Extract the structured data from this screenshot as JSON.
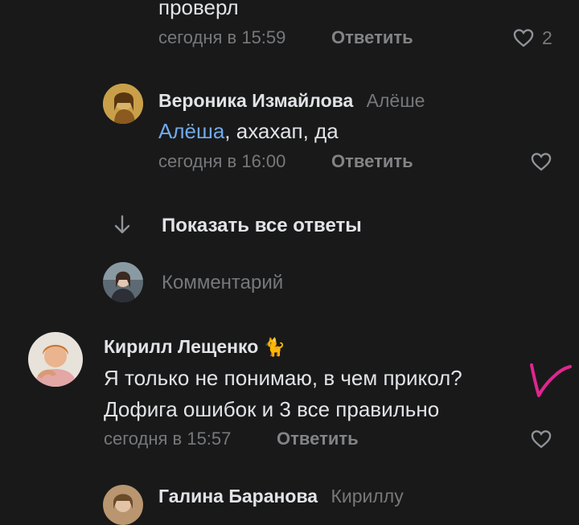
{
  "comment_top": {
    "text_tail": "проверл",
    "time": "сегодня в 15:59",
    "reply_label": "Ответить",
    "likes": "2"
  },
  "reply_veronika": {
    "author": "Вероника Измайлова",
    "reply_to": "Алёше",
    "mention": "Алёша",
    "text": ", ахахап, да",
    "time": "сегодня в 16:00",
    "reply_label": "Ответить"
  },
  "show_replies": {
    "label": "Показать все ответы"
  },
  "reply_input": {
    "placeholder": "Комментарий"
  },
  "comment_kirill": {
    "author": "Кирилл Лещенко",
    "emoji": "🐈",
    "line1": "Я только не понимаю, в чем прикол?",
    "line2": "Дофига ошибок и 3 все правильно",
    "time": "сегодня в 15:57",
    "reply_label": "Ответить",
    "annotation": "V"
  },
  "comment_galina": {
    "author": "Галина Баранова",
    "reply_to": "Кириллу"
  },
  "colors": {
    "background": "#19191a",
    "mention": "#71aaeb",
    "annotation": "#e0258f"
  }
}
